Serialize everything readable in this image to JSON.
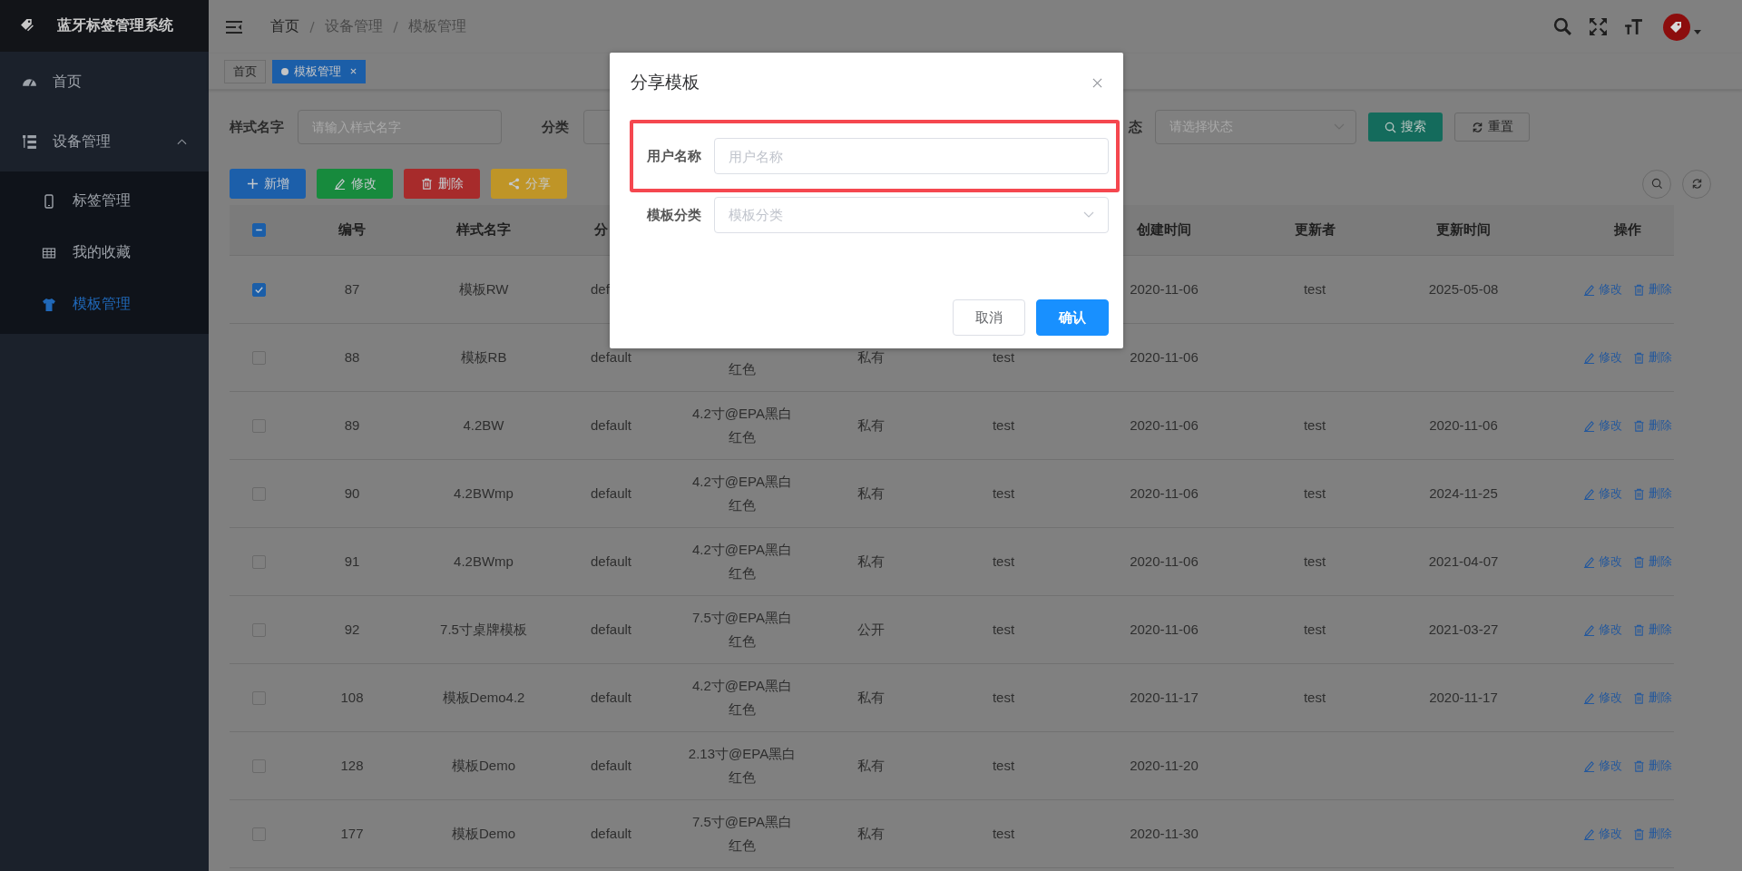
{
  "sidebar": {
    "title": "蓝牙标签管理系统",
    "items": [
      {
        "label": "首页",
        "selected": false
      },
      {
        "label": "设备管理",
        "selected": false,
        "expanded": true,
        "children": [
          {
            "label": "标签管理",
            "selected": false
          },
          {
            "label": "我的收藏",
            "selected": false
          },
          {
            "label": "模板管理",
            "selected": true
          }
        ]
      }
    ]
  },
  "breadcrumb": [
    "首页",
    "设备管理",
    "模板管理"
  ],
  "tags": [
    {
      "label": "首页",
      "selected": false,
      "closable": false
    },
    {
      "label": "模板管理",
      "selected": true,
      "closable": true
    }
  ],
  "filters": [
    {
      "label": "样式名字",
      "placeholder": "请输入样式名字",
      "kind": "input"
    },
    {
      "label": "分类",
      "kind": "input"
    },
    {
      "label": "态",
      "placeholder": "请选择状态",
      "kind": "select"
    }
  ],
  "search_button": "搜索",
  "reset_button": "重置",
  "toolbar": [
    {
      "label": "新增",
      "kind": "add"
    },
    {
      "label": "修改",
      "kind": "edit"
    },
    {
      "label": "删除",
      "kind": "delete"
    },
    {
      "label": "分享",
      "kind": "share"
    }
  ],
  "table": {
    "select_all": {
      "indeterminate": true
    },
    "columns": [
      "编号",
      "样式名字",
      "分",
      null,
      null,
      null,
      "创建时间",
      "更新者",
      "更新时间",
      "操作"
    ],
    "rows": [
      {
        "checked": true,
        "cells": [
          "87",
          "模板RW",
          "def",
          null,
          null,
          null,
          "2020-11-06",
          "test",
          "2025-05-08"
        ],
        "actions": [
          "修改",
          "删除"
        ]
      },
      {
        "checked": false,
        "cells": [
          "88",
          "模板RB",
          "default",
          [
            null,
            "红色"
          ],
          "私有",
          "test",
          "2020-11-06",
          null,
          null
        ],
        "actions": [
          "修改",
          "删除"
        ]
      },
      {
        "checked": false,
        "cells": [
          "89",
          "4.2BW",
          "default",
          [
            "4.2寸@EPA黑白",
            "红色"
          ],
          "私有",
          "test",
          "2020-11-06",
          "test",
          "2020-11-06"
        ],
        "actions": [
          "修改",
          "删除"
        ]
      },
      {
        "checked": false,
        "cells": [
          "90",
          "4.2BWmp",
          "default",
          [
            "4.2寸@EPA黑白",
            "红色"
          ],
          "私有",
          "test",
          "2020-11-06",
          "test",
          "2024-11-25"
        ],
        "actions": [
          "修改",
          "删除"
        ]
      },
      {
        "checked": false,
        "cells": [
          "91",
          "4.2BWmp",
          "default",
          [
            "4.2寸@EPA黑白",
            "红色"
          ],
          "私有",
          "test",
          "2020-11-06",
          "test",
          "2021-04-07"
        ],
        "actions": [
          "修改",
          "删除"
        ]
      },
      {
        "checked": false,
        "cells": [
          "92",
          "7.5寸桌牌模板",
          "default",
          [
            "7.5寸@EPA黑白",
            "红色"
          ],
          "公开",
          "test",
          "2020-11-06",
          "test",
          "2021-03-27"
        ],
        "actions": [
          "修改",
          "删除"
        ]
      },
      {
        "checked": false,
        "cells": [
          "108",
          "模板Demo4.2",
          "default",
          [
            "4.2寸@EPA黑白",
            "红色"
          ],
          "私有",
          "test",
          "2020-11-17",
          "test",
          "2020-11-17"
        ],
        "actions": [
          "修改",
          "删除"
        ]
      },
      {
        "checked": false,
        "cells": [
          "128",
          "模板Demo",
          "default",
          [
            "2.13寸@EPA黑白",
            "红色"
          ],
          "私有",
          "test",
          "2020-11-20",
          null,
          null
        ],
        "actions": [
          "修改",
          "删除"
        ]
      },
      {
        "checked": false,
        "cells": [
          "177",
          "模板Demo",
          "default",
          [
            "7.5寸@EPA黑白",
            "红色"
          ],
          "私有",
          "test",
          "2020-11-30",
          null,
          null
        ],
        "actions": [
          "修改",
          "删除"
        ]
      }
    ]
  },
  "modal": {
    "title": "分享模板",
    "fields": [
      {
        "label": "用户名称",
        "placeholder": "用户名称",
        "kind": "input",
        "highlighted": true
      },
      {
        "label": "模板分类",
        "placeholder": "模板分类",
        "kind": "select",
        "highlighted": false
      }
    ],
    "buttons": [
      {
        "label": "取消",
        "kind": "default"
      },
      {
        "label": "确认",
        "kind": "primary"
      }
    ]
  }
}
